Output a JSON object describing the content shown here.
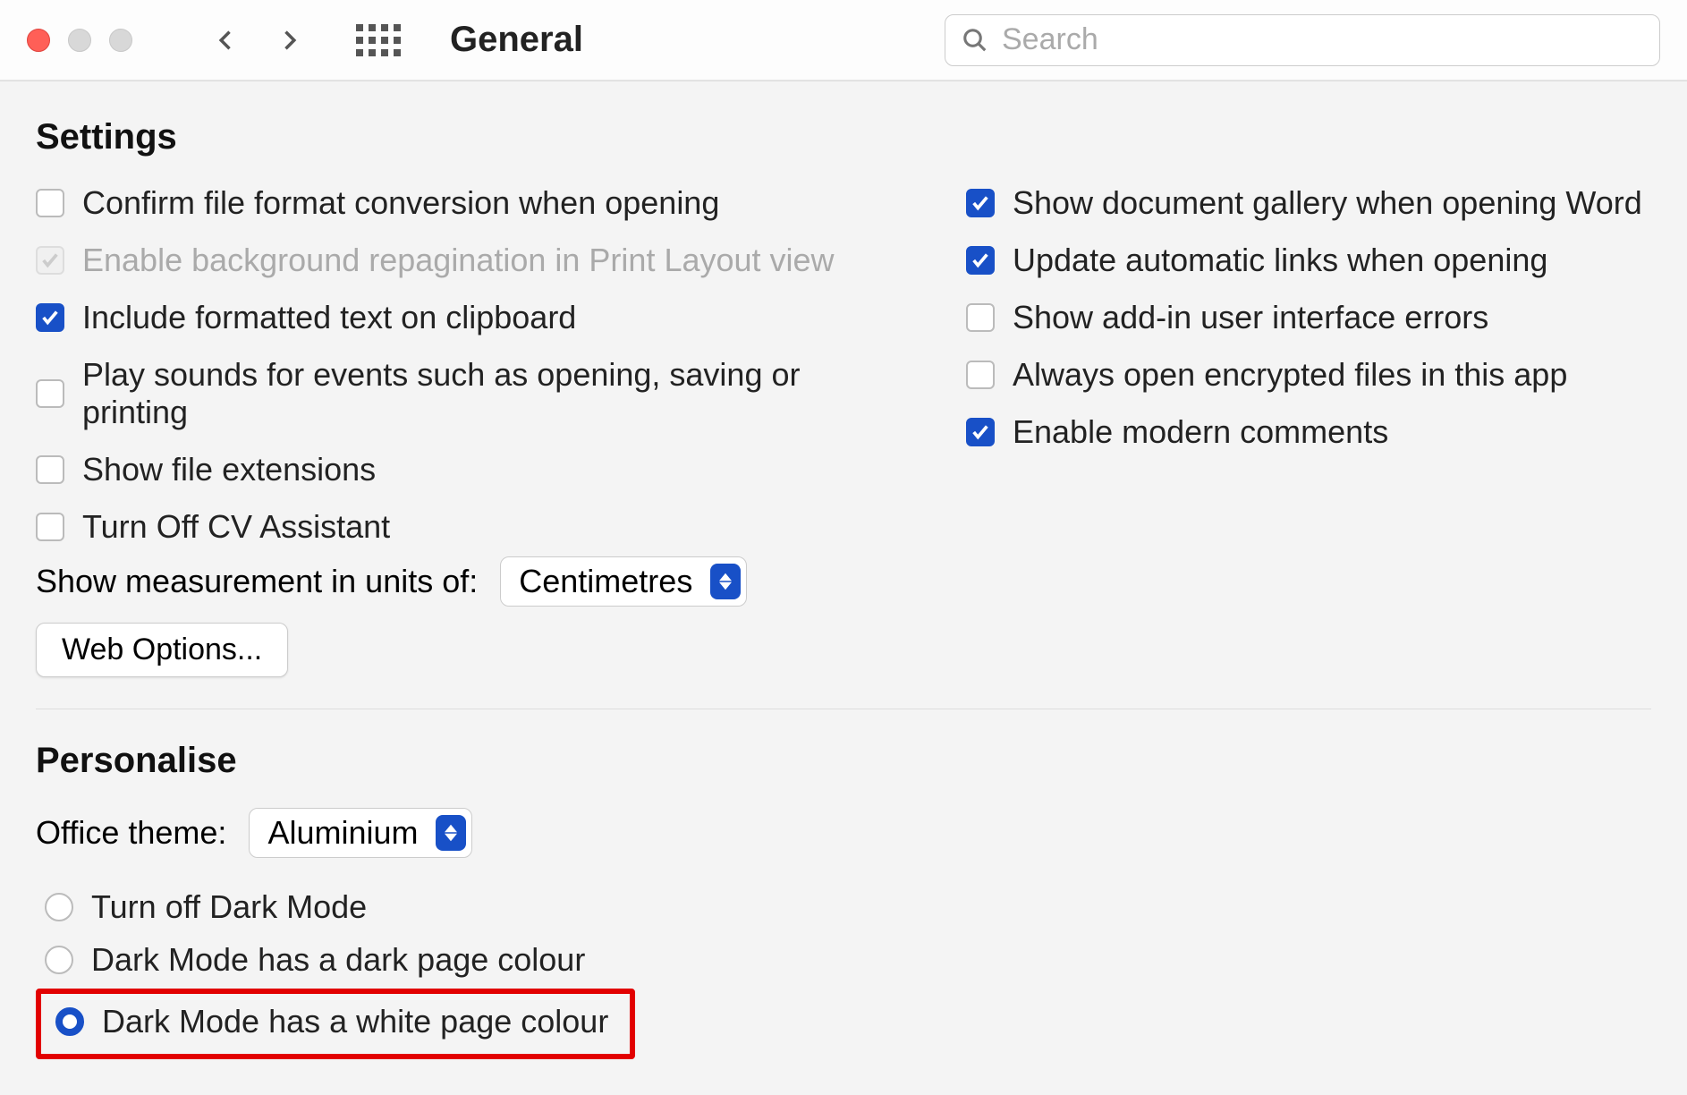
{
  "header": {
    "title": "General",
    "search_placeholder": "Search"
  },
  "settings": {
    "heading": "Settings",
    "left": [
      {
        "label": "Confirm file format conversion when opening",
        "checked": false,
        "disabled": false
      },
      {
        "label": "Enable background repagination in Print Layout view",
        "checked": true,
        "disabled": true
      },
      {
        "label": "Include formatted text on clipboard",
        "checked": true,
        "disabled": false
      },
      {
        "label": "Play sounds for events such as opening, saving or printing",
        "checked": false,
        "disabled": false
      },
      {
        "label": "Show file extensions",
        "checked": false,
        "disabled": false
      },
      {
        "label": "Turn Off CV Assistant",
        "checked": false,
        "disabled": false
      }
    ],
    "right": [
      {
        "label": "Show document gallery when opening Word",
        "checked": true
      },
      {
        "label": "Update automatic links when opening",
        "checked": true
      },
      {
        "label": "Show add-in user interface errors",
        "checked": false
      },
      {
        "label": "Always open encrypted files in this app",
        "checked": false
      },
      {
        "label": "Enable modern comments",
        "checked": true
      }
    ],
    "measurement_label": "Show measurement in units of:",
    "measurement_value": "Centimetres",
    "web_options_label": "Web Options..."
  },
  "personalise": {
    "heading": "Personalise",
    "theme_label": "Office theme:",
    "theme_value": "Aluminium",
    "radios": [
      {
        "label": "Turn off Dark Mode",
        "selected": false,
        "highlighted": false
      },
      {
        "label": "Dark Mode has a dark page colour",
        "selected": false,
        "highlighted": false
      },
      {
        "label": "Dark Mode has a white page colour",
        "selected": true,
        "highlighted": true
      }
    ]
  },
  "colors": {
    "accent": "#1850c7",
    "highlight_border": "#e20000"
  }
}
